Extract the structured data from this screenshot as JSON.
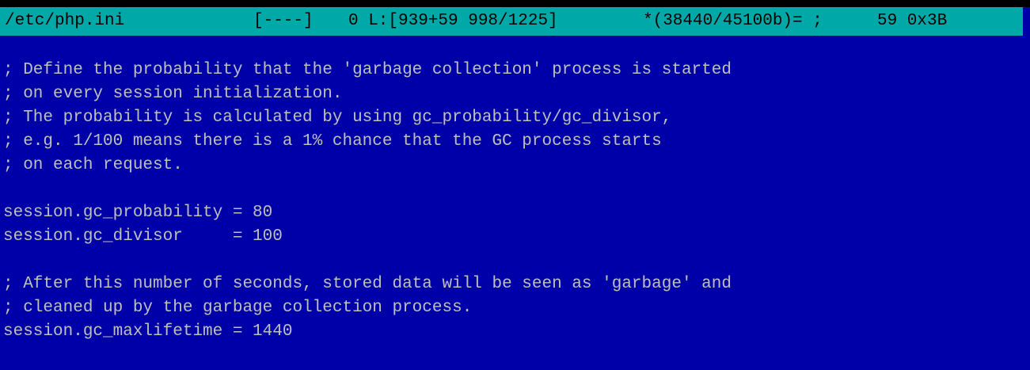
{
  "status_bar": {
    "file_path": "/etc/php.ini",
    "flags": "[----]",
    "position": "0 L:[939+59 998/1225]",
    "offset": "*(38440/45100b)= ;",
    "char_code": "59 0x3B"
  },
  "editor": {
    "lines": [
      "",
      "; Define the probability that the 'garbage collection' process is started",
      "; on every session initialization.",
      "; The probability is calculated by using gc_probability/gc_divisor,",
      "; e.g. 1/100 means there is a 1% chance that the GC process starts",
      "; on each request.",
      "",
      "session.gc_probability = 80",
      "session.gc_divisor     = 100",
      "",
      "; After this number of seconds, stored data will be seen as 'garbage' and",
      "; cleaned up by the garbage collection process.",
      "session.gc_maxlifetime = 1440"
    ]
  },
  "colors": {
    "background": "#0000a8",
    "text": "#bfbfbf",
    "status_bar_bg": "#00a8a8",
    "status_bar_text": "#000000"
  }
}
